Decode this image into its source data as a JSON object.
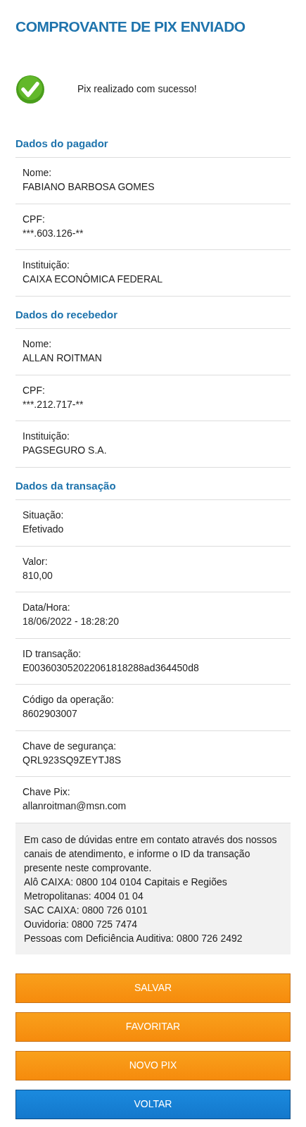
{
  "title": "COMPROVANTE DE PIX ENVIADO",
  "status": {
    "message": "Pix realizado com sucesso!"
  },
  "sections": [
    {
      "heading": "Dados do pagador",
      "fields": [
        {
          "label": "Nome:",
          "value": "FABIANO BARBOSA GOMES"
        },
        {
          "label": "CPF:",
          "value": "***.603.126-**"
        },
        {
          "label": "Instituição:",
          "value": "CAIXA ECONÔMICA FEDERAL"
        }
      ]
    },
    {
      "heading": "Dados do recebedor",
      "fields": [
        {
          "label": "Nome:",
          "value": "ALLAN ROITMAN"
        },
        {
          "label": "CPF:",
          "value": "***.212.717-**"
        },
        {
          "label": "Instituição:",
          "value": "PAGSEGURO S.A."
        }
      ]
    },
    {
      "heading": "Dados da transação",
      "fields": [
        {
          "label": "Situação:",
          "value": "Efetivado"
        },
        {
          "label": "Valor:",
          "value": "810,00"
        },
        {
          "label": "Data/Hora:",
          "value": "18/06/2022 - 18:28:20"
        },
        {
          "label": "ID transação:",
          "value": "E003603052022061818288ad364450d8"
        },
        {
          "label": "Código da operação:",
          "value": "8602903007"
        },
        {
          "label": "Chave de segurança:",
          "value": "QRL923SQ9ZEYTJ8S"
        },
        {
          "label": "Chave Pix:",
          "value": "allanroitman@msn.com"
        }
      ]
    }
  ],
  "info": [
    "Em caso de dúvidas entre em contato através dos nossos canais de atendimento, e informe o ID da transação presente neste comprovante.",
    "Alô CAIXA: 0800 104 0104 Capitais e Regiões Metropolitanas: 4004 01 04",
    "SAC CAIXA: 0800 726 0101",
    "Ouvidoria: 0800 725 7474",
    "Pessoas com Deficiência Auditiva: 0800 726 2492"
  ],
  "buttons": [
    {
      "label": "SALVAR",
      "kind": "secondary"
    },
    {
      "label": "FAVORITAR",
      "kind": "secondary"
    },
    {
      "label": "NOVO PIX",
      "kind": "secondary"
    },
    {
      "label": "VOLTAR",
      "kind": "primary"
    }
  ]
}
